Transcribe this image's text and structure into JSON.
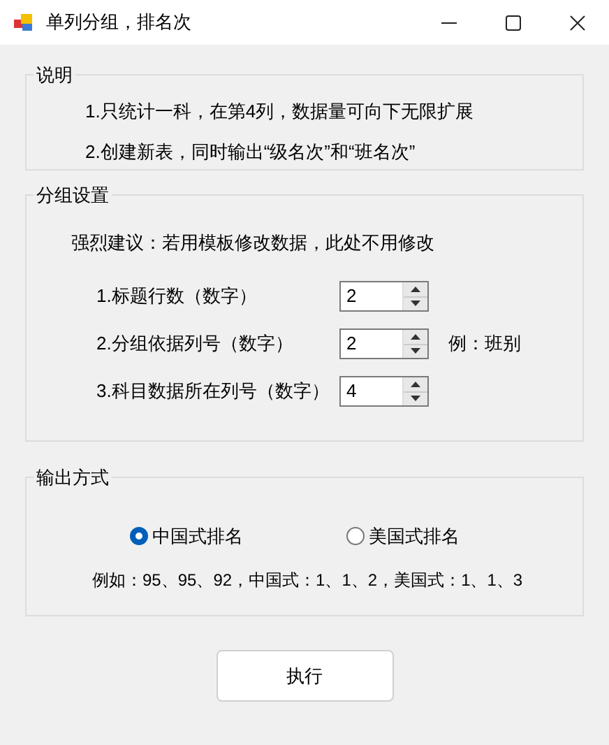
{
  "window": {
    "title": "单列分组，排名次"
  },
  "notes_group": {
    "title": "说明",
    "lines": [
      "1.只统计一科，在第4列，数据量可向下无限扩展",
      "2.创建新表，同时输出“级名次”和“班名次”"
    ]
  },
  "settings_group": {
    "title": "分组设置",
    "advice": "强烈建议：若用模板修改数据，此处不用修改",
    "fields": [
      {
        "label": "1.标题行数（数字）",
        "value": "2"
      },
      {
        "label": "2.分组依据列号（数字）",
        "value": "2",
        "hint": "例：班别"
      },
      {
        "label": "3.科目数据所在列号（数字）",
        "value": "4"
      }
    ]
  },
  "output_group": {
    "title": "输出方式",
    "options": [
      {
        "label": "中国式排名",
        "selected": true
      },
      {
        "label": "美国式排名",
        "selected": false
      }
    ],
    "example": "例如：95、95、92，中国式：1、1、2，美国式：1、1、3"
  },
  "buttons": [
    "执行"
  ]
}
